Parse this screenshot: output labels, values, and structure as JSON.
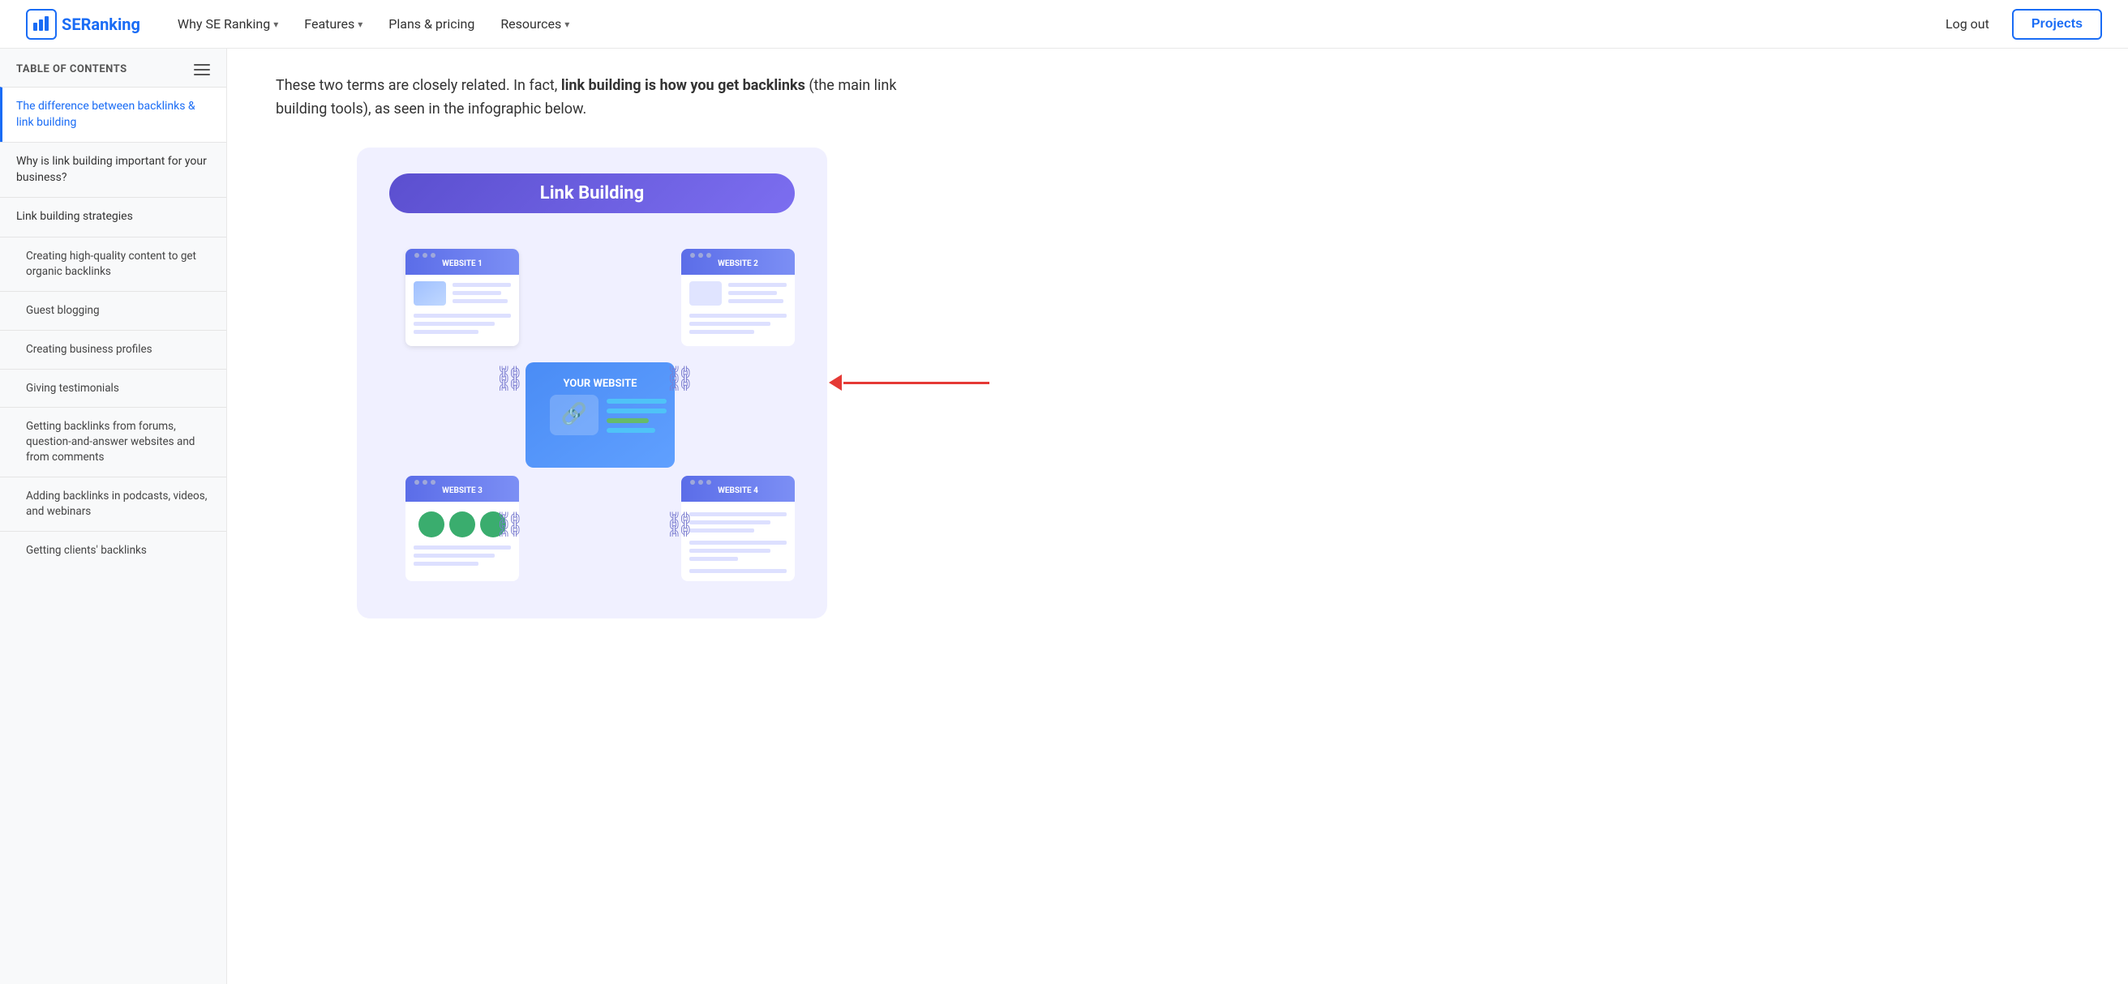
{
  "navbar": {
    "logo_text_se": "SE",
    "logo_text_ranking": "Ranking",
    "nav_items": [
      {
        "label": "Why SE Ranking",
        "has_dropdown": true
      },
      {
        "label": "Features",
        "has_dropdown": true
      },
      {
        "label": "Plans & pricing",
        "has_dropdown": false
      },
      {
        "label": "Resources",
        "has_dropdown": true
      }
    ],
    "logout_label": "Log out",
    "projects_label": "Projects"
  },
  "sidebar": {
    "toc_title": "TABLE OF CONTENTS",
    "items": [
      {
        "id": "diff",
        "label": "The difference between backlinks & link building",
        "active": true,
        "sub": false
      },
      {
        "id": "why",
        "label": "Why is link building important for your business?",
        "active": false,
        "sub": false
      },
      {
        "id": "strategies",
        "label": "Link building strategies",
        "active": false,
        "sub": false
      },
      {
        "id": "highquality",
        "label": "Creating high-quality content to get organic backlinks",
        "active": false,
        "sub": true
      },
      {
        "id": "guest",
        "label": "Guest blogging",
        "active": false,
        "sub": true
      },
      {
        "id": "business",
        "label": "Creating business profiles",
        "active": false,
        "sub": true
      },
      {
        "id": "testimonials",
        "label": "Giving testimonials",
        "active": false,
        "sub": true
      },
      {
        "id": "forums",
        "label": "Getting backlinks from forums, question-and-answer websites and from comments",
        "active": false,
        "sub": true
      },
      {
        "id": "podcasts",
        "label": "Adding backlinks in podcasts, videos, and webinars",
        "active": false,
        "sub": true
      },
      {
        "id": "clients",
        "label": "Getting clients' backlinks",
        "active": false,
        "sub": true
      }
    ]
  },
  "content": {
    "intro": "These two terms are closely related. In fact, ",
    "intro_bold": "link building is how you get backlinks",
    "intro_end": " (the main link building tools), as seen in the infographic below.",
    "infographic": {
      "title": "Link Building",
      "website1": "WEBSITE 1",
      "website2": "WEBSITE 2",
      "website3": "WEBSITE 3",
      "website4": "WEBSITE 4",
      "your_website": "YOUR WEBSITE"
    }
  }
}
